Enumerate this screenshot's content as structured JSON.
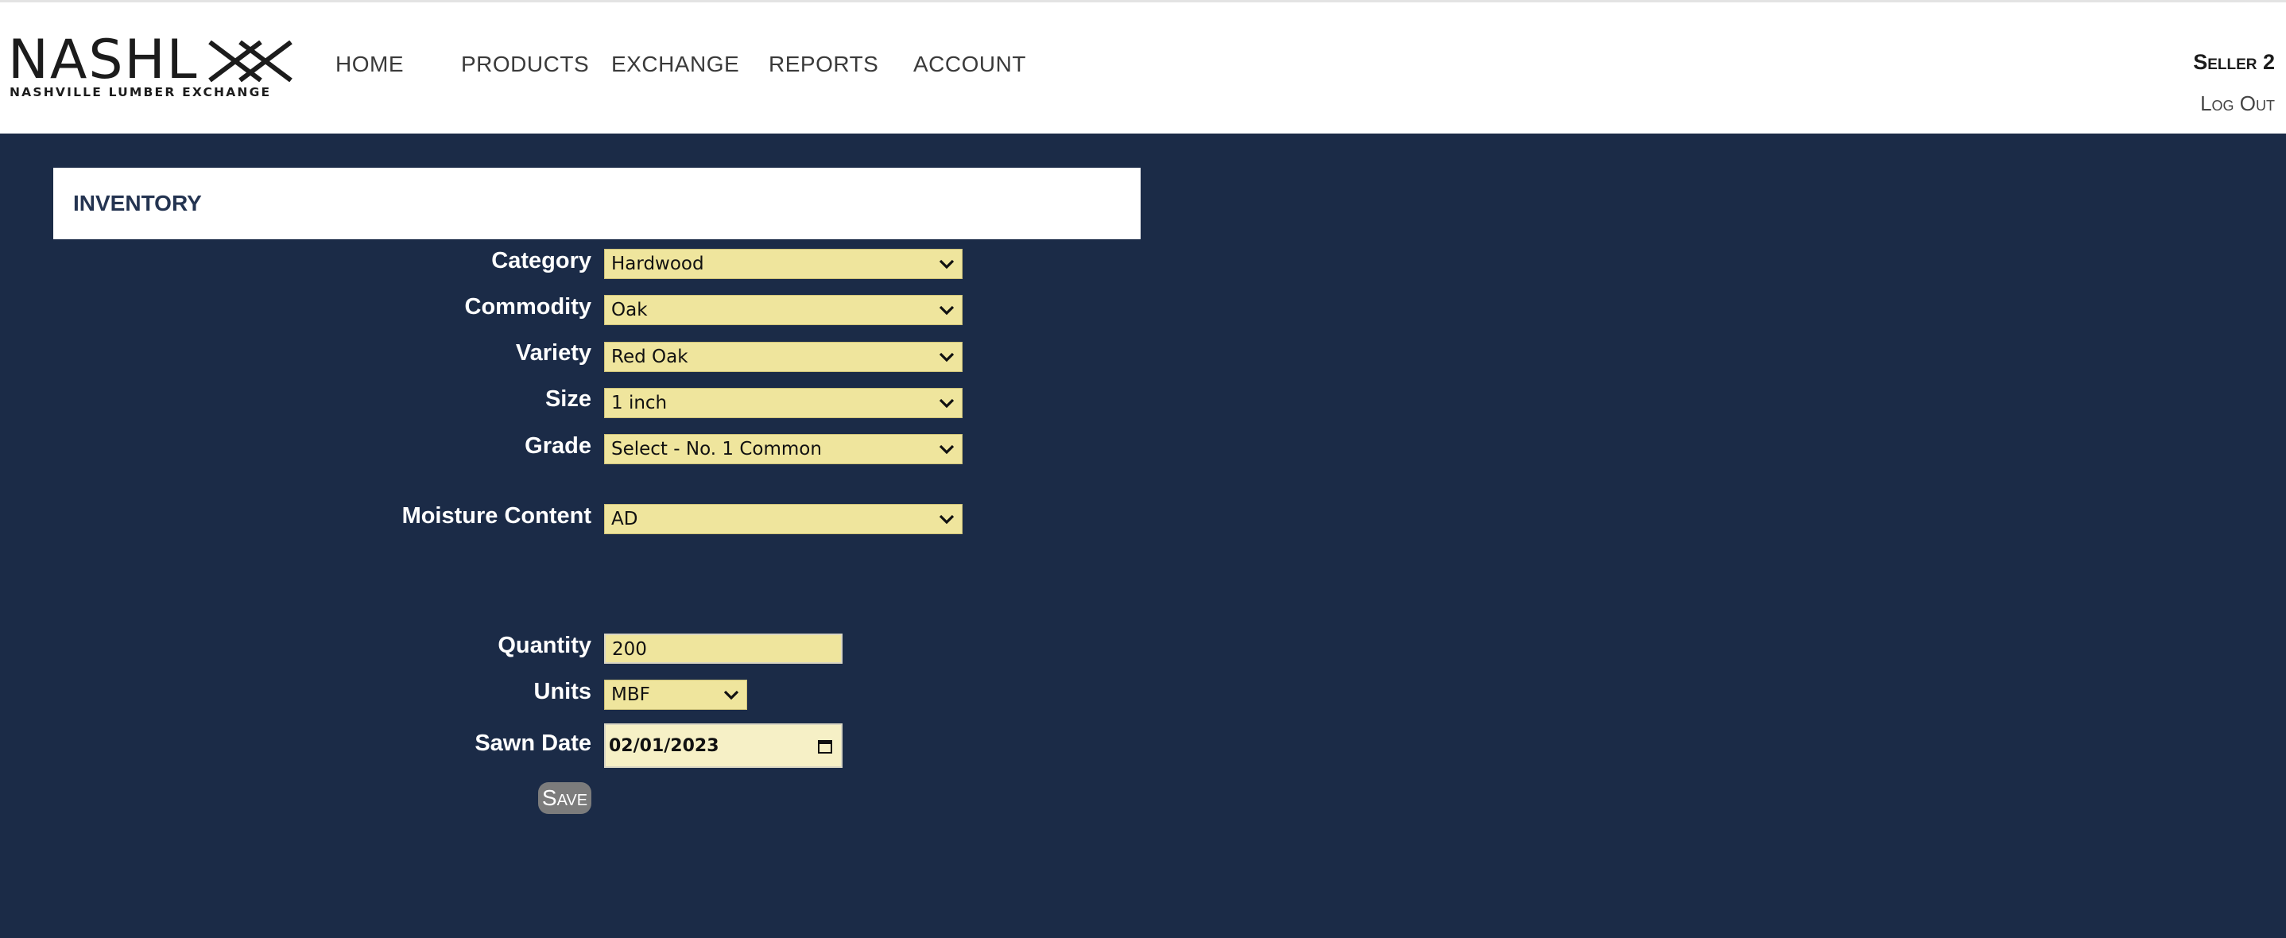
{
  "brand": {
    "logo_text": "NASHL",
    "logo_subtitle": "NASHVILLE LUMBER EXCHANGE"
  },
  "nav": {
    "items": [
      {
        "label": "HOME"
      },
      {
        "label": "PRODUCTS"
      },
      {
        "label": "EXCHANGE"
      },
      {
        "label": "REPORTS"
      },
      {
        "label": "ACCOUNT"
      }
    ]
  },
  "user": {
    "name": "Seller 2",
    "logout_label": "Log Out"
  },
  "panel": {
    "title": "INVENTORY"
  },
  "form": {
    "category": {
      "label": "Category",
      "value": "Hardwood"
    },
    "commodity": {
      "label": "Commodity",
      "value": "Oak"
    },
    "variety": {
      "label": "Variety",
      "value": "Red Oak"
    },
    "size": {
      "label": "Size",
      "value": "1 inch"
    },
    "grade": {
      "label": "Grade",
      "value": "Select - No. 1 Common"
    },
    "moisture": {
      "label": "Moisture Content",
      "value": "AD"
    },
    "quantity": {
      "label": "Quantity",
      "value": "200"
    },
    "units": {
      "label": "Units",
      "value": "MBF"
    },
    "sawn_date": {
      "label": "Sawn Date",
      "value": "02/01/2023"
    },
    "save_label": "Save"
  },
  "colors": {
    "page_background": "#1b2b47",
    "field_background": "#efe59d",
    "button": "#7c7c7c"
  },
  "icons": {
    "dropdown": "chevron-down-icon",
    "date": "calendar-icon"
  }
}
